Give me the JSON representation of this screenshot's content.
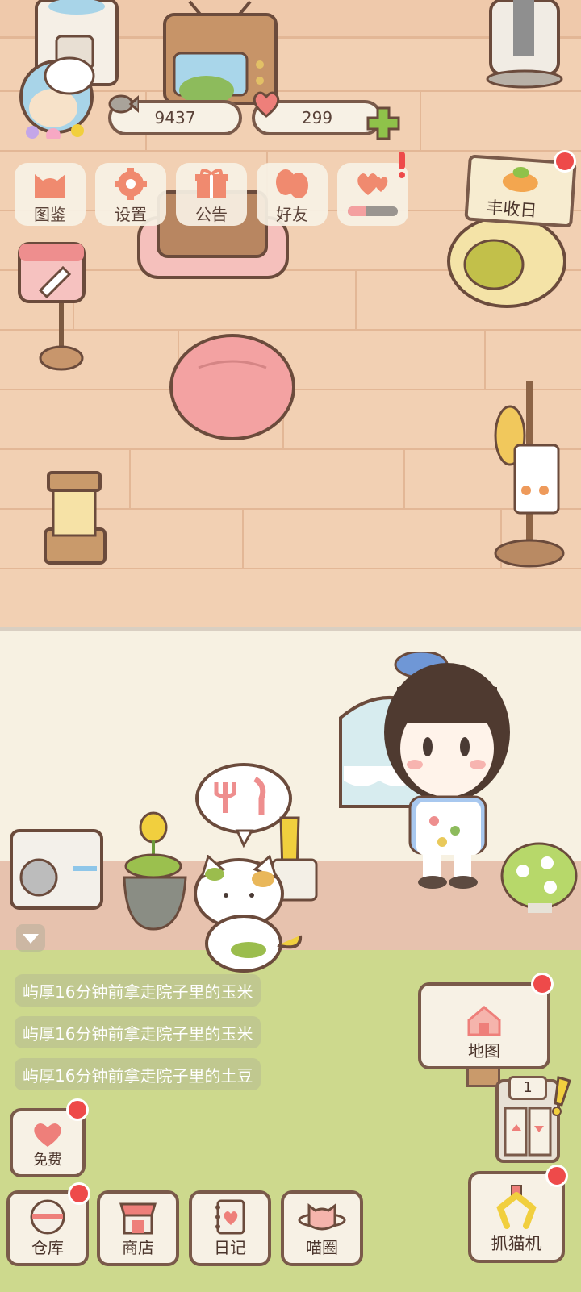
{
  "hud": {
    "fish_count": "9437",
    "heart_count": "299"
  },
  "menu": [
    {
      "label": "图鉴",
      "icon": "cat-head-icon"
    },
    {
      "label": "设置",
      "icon": "gear-icon"
    },
    {
      "label": "公告",
      "icon": "gift-icon"
    },
    {
      "label": "好友",
      "icon": "friends-icon"
    },
    {
      "label": "",
      "icon": "hearts-icon"
    }
  ],
  "event": {
    "label": "丰收日"
  },
  "logs": [
    "屿厚16分钟前拿走院子里的玉米",
    "屿厚16分钟前拿走院子里的玉米",
    "屿厚16分钟前拿走院子里的土豆"
  ],
  "map_button": {
    "label": "地图"
  },
  "elevator": {
    "floor": "1"
  },
  "free_button": {
    "label": "免费"
  },
  "bottom_bar": [
    {
      "label": "仓库",
      "icon": "storage-icon"
    },
    {
      "label": "商店",
      "icon": "shop-icon"
    },
    {
      "label": "日记",
      "icon": "diary-icon"
    },
    {
      "label": "喵圈",
      "icon": "cat-planet-icon"
    }
  ],
  "claw_button": {
    "label": "抓猫机"
  },
  "colors": {
    "accent_red": "#ee4a4a",
    "outline": "#7a5a4a",
    "floor": "#f2d0b3",
    "grass": "#cdd98d"
  }
}
